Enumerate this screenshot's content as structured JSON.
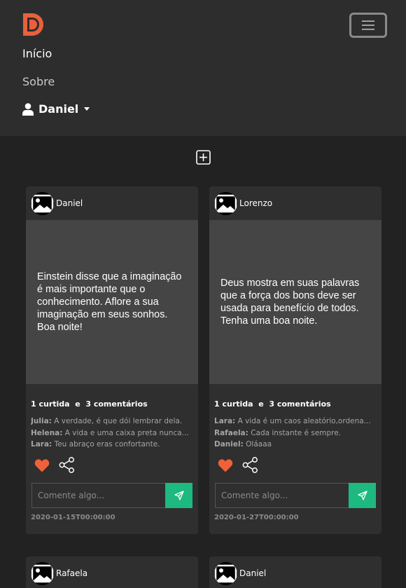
{
  "nav": {
    "links": [
      "Início",
      "Sobre"
    ],
    "user": "Daniel",
    "brand_color": "#e8613c"
  },
  "posts": [
    {
      "author": "Daniel",
      "text": "Einstein disse que a imaginação é mais importante que o conhecimento. Aflore a sua imaginação em seus sonhos. Boa noite!",
      "likes": "1 curtida",
      "comments_count": "3 comentários",
      "comments": [
        {
          "who": "Julia:",
          "text": "A verdade, é que dói lembrar dela."
        },
        {
          "who": "Helena:",
          "text": "A vida e uma caixa preta nunca..."
        },
        {
          "who": "Lara:",
          "text": "Teu abraço eras confortante."
        }
      ],
      "placeholder": "Comente algo...",
      "date": "2020-01-15T00:00:00"
    },
    {
      "author": "Lorenzo",
      "text": "Deus mostra em suas palavras que a força dos bons deve ser usada para benefício de todos. Tenha uma boa noite.",
      "likes": "1 curtida",
      "comments_count": "3 comentários",
      "comments": [
        {
          "who": "Lara:",
          "text": "A vida é um caos aleatório,ordena..."
        },
        {
          "who": "Rafaela:",
          "text": "Cada instante é sempre."
        },
        {
          "who": "Daniel:",
          "text": "Oláaaa"
        }
      ],
      "placeholder": "Comente algo...",
      "date": "2020-01-27T00:00:00"
    },
    {
      "author": "Rafaela"
    },
    {
      "author": "Daniel"
    }
  ],
  "colors": {
    "accent": "#1db980",
    "heart": "#f0613a"
  }
}
